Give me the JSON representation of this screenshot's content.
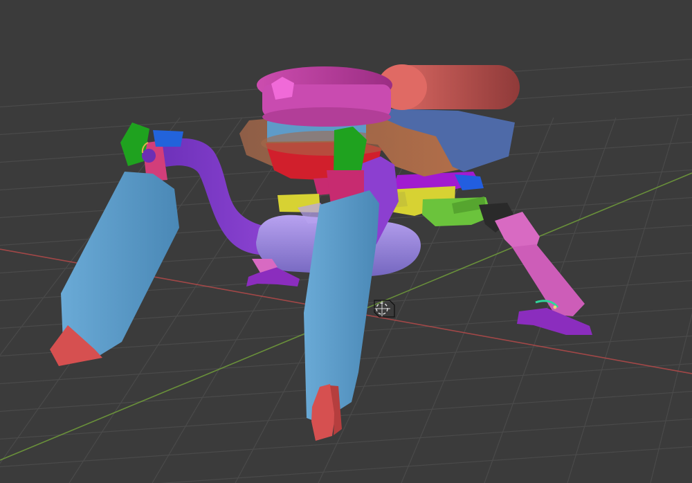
{
  "app": {
    "type": "3d-viewport"
  },
  "viewport": {
    "background_color": "#3b3b3b",
    "grid_color": "#505050",
    "x_axis_color": "#b54a4a",
    "y_axis_color": "#6f9a3a"
  },
  "scene": {
    "object_colors": {
      "tank": "#d75f5a",
      "top_cap": "#d24fb4",
      "body_orange": "#a86a45",
      "body_blue": "#4e6aa8",
      "leg_blue": "#5e9bc8",
      "leg_purple": "#8c3fd0",
      "joint_green": "#1fa21f",
      "joint_pink": "#d23e7a",
      "foot_red": "#d65050",
      "yellow": "#d7d233",
      "lime": "#6bc33c",
      "lavender": "#9a86d8",
      "pink_leg": "#d86ac2",
      "black": "#2d2d2d",
      "red_block": "#d11f2c",
      "magenta": "#b12cc7",
      "blue_tip": "#2263db",
      "violet_feet": "#8b2dbe"
    },
    "icons": {
      "origin": "3d-cursor-icon"
    }
  }
}
